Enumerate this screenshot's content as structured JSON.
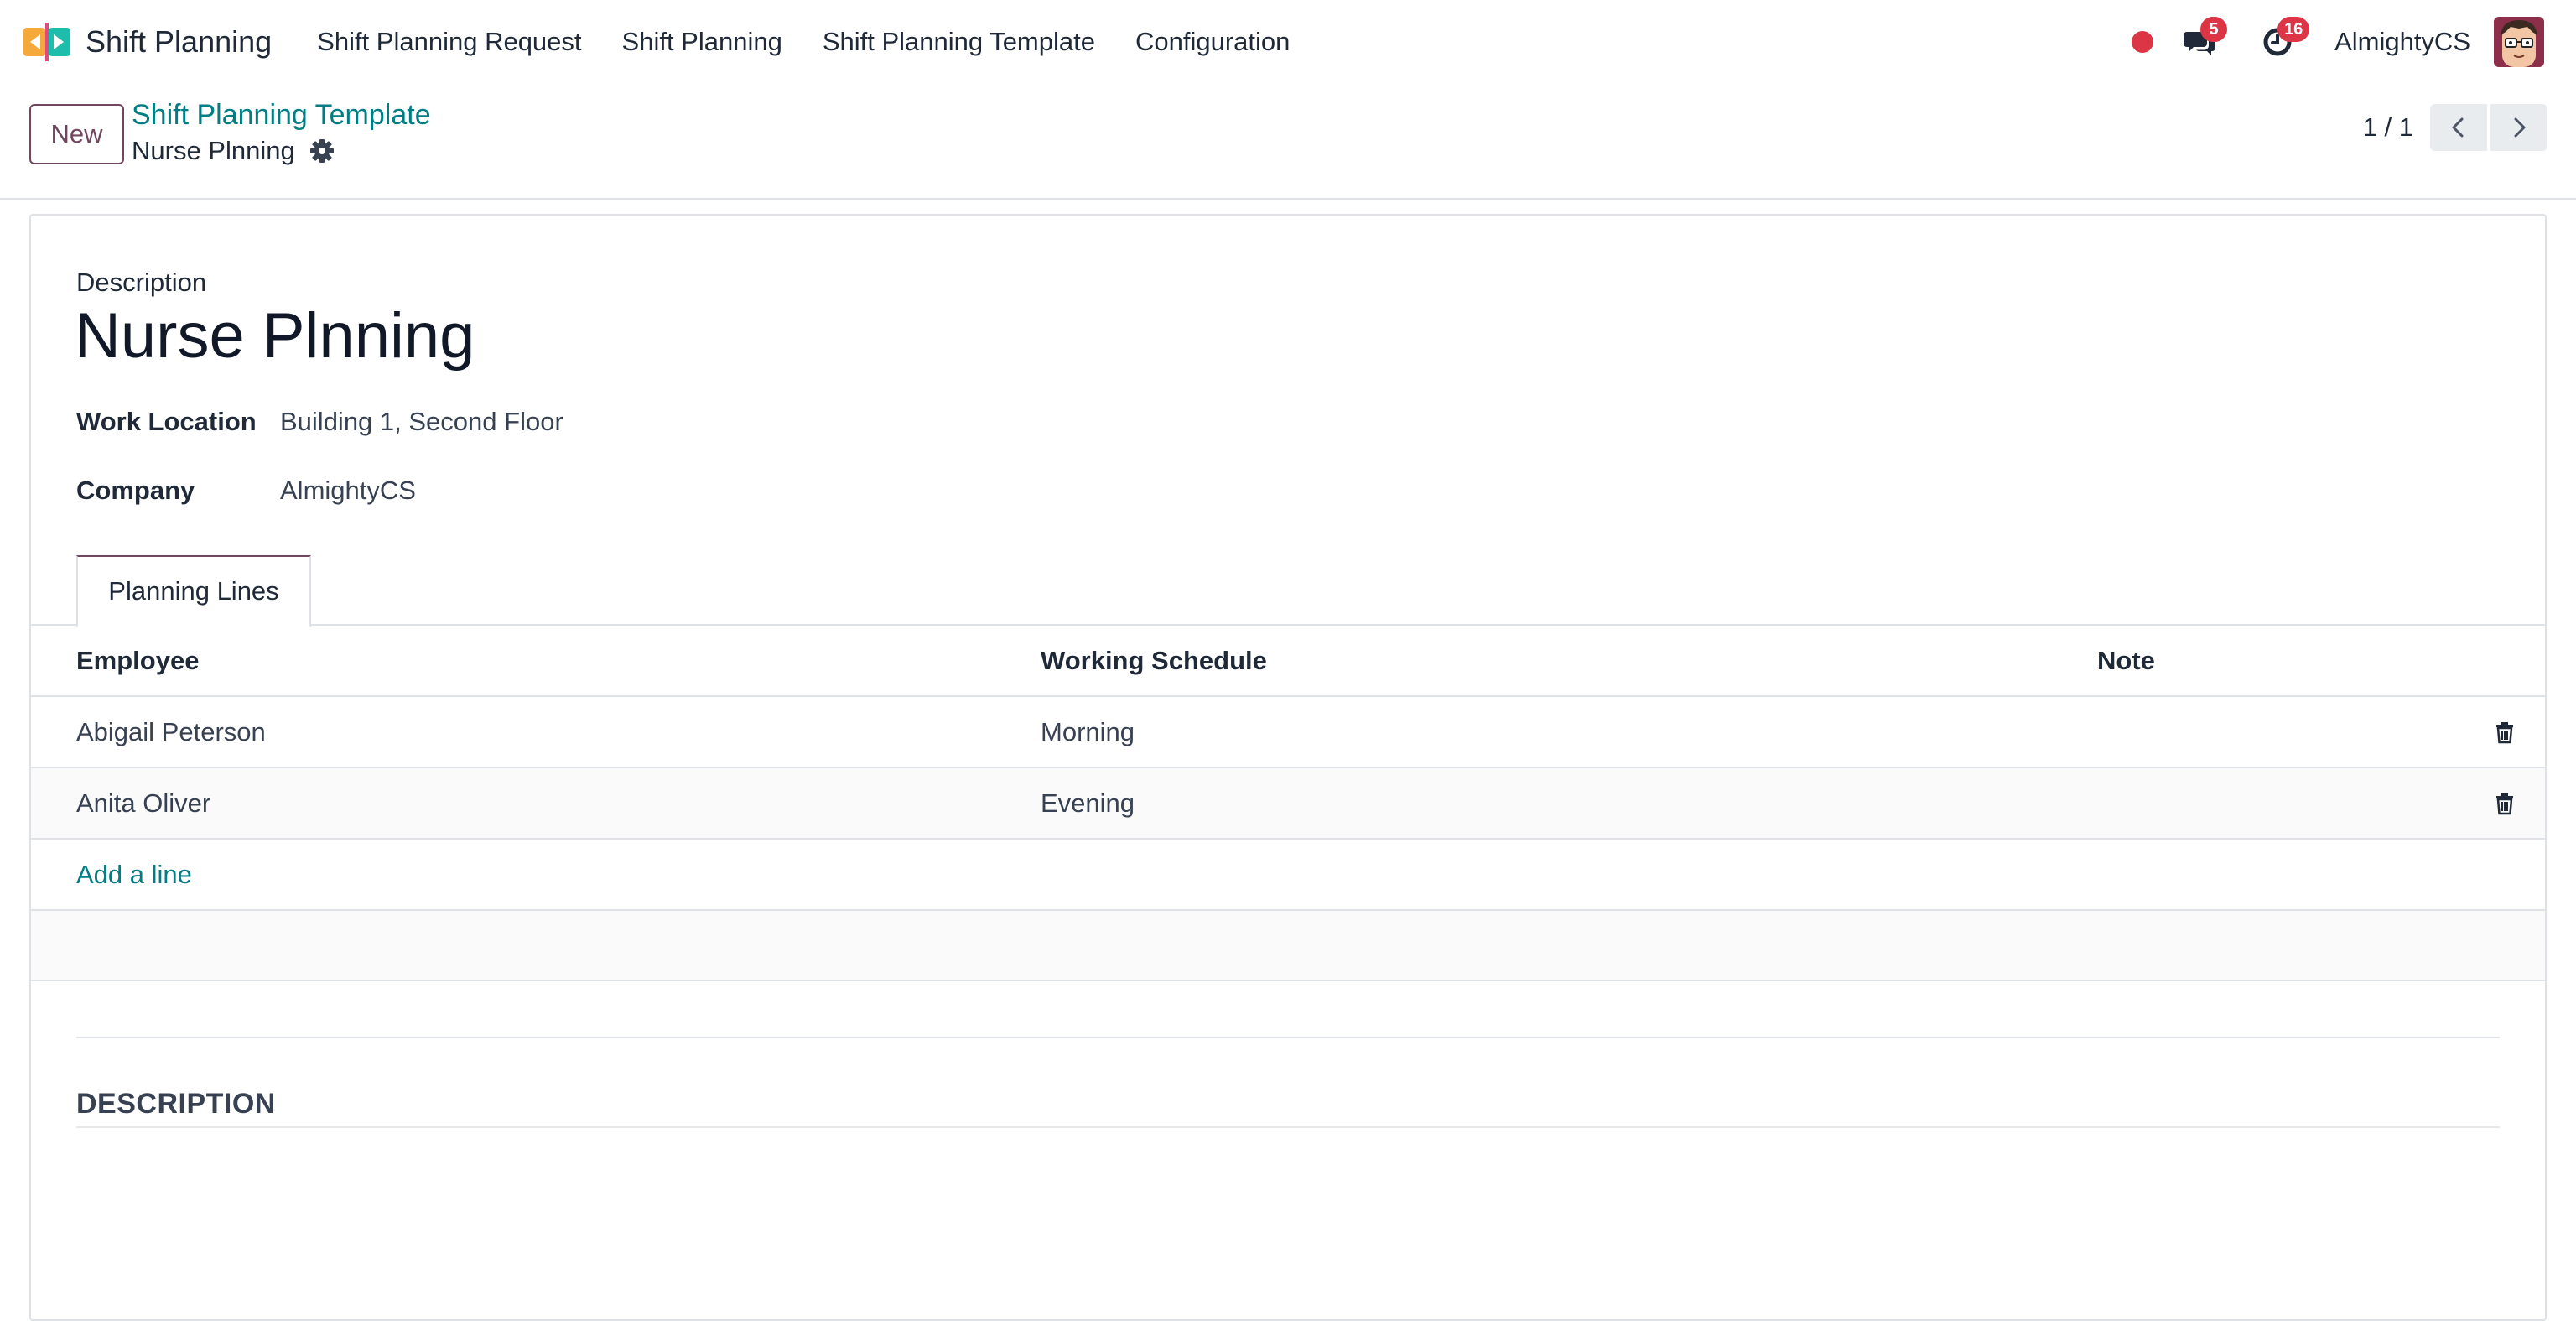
{
  "app": {
    "name": "Shift Planning",
    "logo_icon": "shift-planning-logo-icon"
  },
  "nav": {
    "menu": [
      {
        "label": "Shift Planning Request"
      },
      {
        "label": "Shift Planning"
      },
      {
        "label": "Shift Planning Template"
      },
      {
        "label": "Configuration"
      }
    ],
    "messages_badge": "5",
    "activities_badge": "16",
    "user_name": "AlmightyCS",
    "status_color": "#dc3545"
  },
  "control_panel": {
    "new_label": "New",
    "breadcrumb": "Shift Planning Template",
    "record_title": "Nurse Plnning",
    "pager_value": "1 / 1"
  },
  "form": {
    "description_label": "Description",
    "name": "Nurse Plnning",
    "work_location_label": "Work Location",
    "work_location_value": "Building 1, Second Floor",
    "company_label": "Company",
    "company_value": "AlmightyCS",
    "tab_label": "Planning Lines",
    "table": {
      "headers": {
        "employee": "Employee",
        "schedule": "Working Schedule",
        "note": "Note"
      },
      "rows": [
        {
          "employee": "Abigail Peterson",
          "schedule": "Morning",
          "note": ""
        },
        {
          "employee": "Anita Oliver",
          "schedule": "Evening",
          "note": ""
        }
      ],
      "add_line": "Add a line"
    },
    "section_title": "DESCRIPTION"
  },
  "colors": {
    "primary": "#71475f",
    "link": "#017e84",
    "badge": "#dc3545"
  }
}
